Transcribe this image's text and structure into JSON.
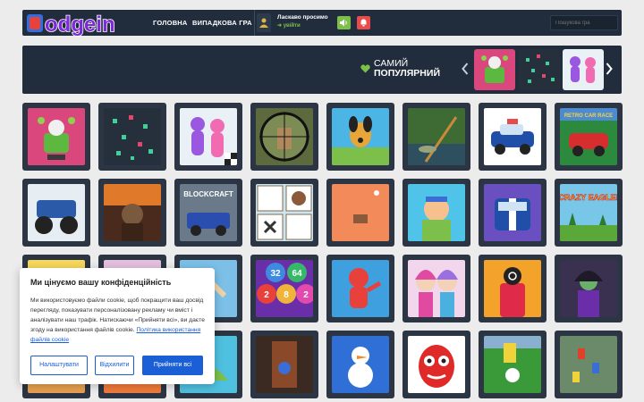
{
  "header": {
    "logo_text": "Todgein",
    "nav": {
      "home": "ГОЛОВНА",
      "random": "ВИПАДКОВА ГРА"
    },
    "user": {
      "welcome": "Ласкаво просимо",
      "login": "увійти"
    },
    "search": {
      "placeholder": "Пошукова гра"
    }
  },
  "popular": {
    "title_line1": "САМИЙ",
    "title_line2": "ПОПУЛЯРНИЙ"
  },
  "cookie": {
    "title": "Ми цінуємо вашу конфіденційність",
    "text": "Ми використовуємо файли cookie, щоб покращити ваш досвід перегляду, показувати персоналізовану рекламу чи вміст і аналізувати наш трафік. Натискаючи «Прийняти всі», ви даєте згоду на використання файлів cookie.",
    "link": "Політика використання файлів cookie",
    "buttons": {
      "settings": "Налаштувати",
      "reject": "Відхилити",
      "accept": "Прийняти всі"
    }
  },
  "tiles": {
    "r1c1": "logo-thumb-green-robot",
    "r1c2": "confetti-thumb",
    "r1c3": "runners-thumb",
    "r1c4": "sniper-thumb",
    "r1c5": "pluto-thumb",
    "r1c6": "fishing-thumb",
    "r1c7": "police-car-thumb",
    "r1c8": "retro-car-race-thumb",
    "r2c1": "monster-truck-thumb",
    "r2c2": "zombie-thumb",
    "r2c3_text": "BLOCKCRAFT",
    "r3c4": [
      "32",
      "64",
      "2",
      "8",
      "2"
    ],
    "r2c8_text": "CRAZY EAGLE!",
    "r1c8_text": "RETRO CAR RACE"
  }
}
